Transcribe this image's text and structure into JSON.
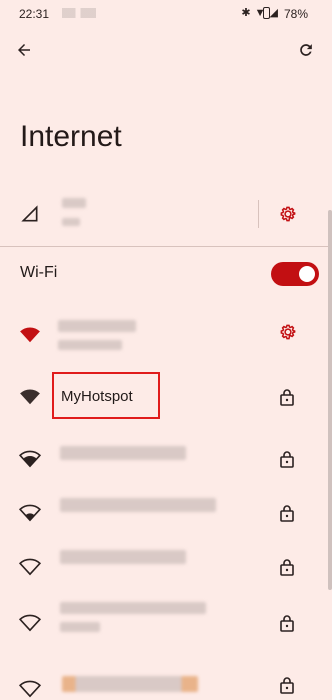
{
  "status_bar": {
    "time": "22:31",
    "battery": "78%"
  },
  "header": {
    "title": "Internet"
  },
  "wifi": {
    "label": "Wi-Fi",
    "enabled": true
  },
  "networks": [
    {
      "name": "",
      "connected": true,
      "secured": false,
      "icon": "wifi-filled-red-icon",
      "trailing": "gear-icon"
    },
    {
      "name": "MyHotspot",
      "secured": true,
      "icon": "wifi-filled-icon",
      "trailing": "lock-icon"
    },
    {
      "name": "",
      "secured": true,
      "icon": "wifi-outline-icon",
      "trailing": "lock-icon"
    },
    {
      "name": "",
      "secured": true,
      "icon": "wifi-outline-icon",
      "trailing": "lock-icon"
    },
    {
      "name": "",
      "secured": true,
      "icon": "wifi-outline-icon",
      "trailing": "lock-icon"
    },
    {
      "name": "",
      "secured": true,
      "icon": "wifi-outline-icon",
      "trailing": "lock-icon"
    },
    {
      "name": "",
      "secured": true,
      "icon": "wifi-outline-icon",
      "trailing": "lock-icon"
    }
  ],
  "colors": {
    "accent": "#c20f12",
    "background": "#fdebe7",
    "highlight": "#e01b1b"
  }
}
